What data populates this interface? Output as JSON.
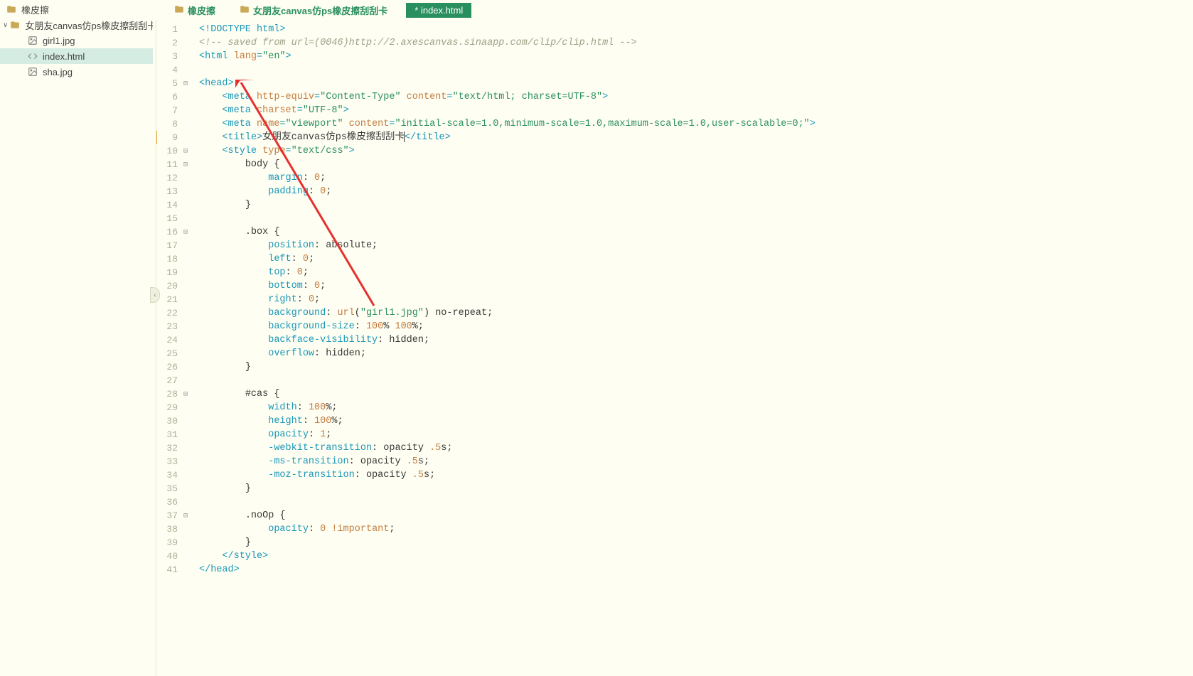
{
  "sidebar": {
    "items": [
      {
        "name": "folder-root",
        "label": "橡皮擦",
        "icon": "folder",
        "level": 0,
        "chevron": ""
      },
      {
        "name": "folder-project",
        "label": "女朋友canvas仿ps橡皮擦刮刮卡",
        "icon": "folder",
        "level": 1,
        "chevron": "∨",
        "expanded": true
      },
      {
        "name": "file-girl1",
        "label": "girl1.jpg",
        "icon": "image",
        "level": 2
      },
      {
        "name": "file-index",
        "label": "index.html",
        "icon": "code",
        "level": 2,
        "active": true
      },
      {
        "name": "file-sha",
        "label": "sha.jpg",
        "icon": "image",
        "level": 2
      }
    ]
  },
  "breadcrumbs": {
    "items": [
      {
        "label": "橡皮擦",
        "type": "folder"
      },
      {
        "label": "女朋友canvas仿ps橡皮擦刮刮卡",
        "type": "folder"
      },
      {
        "label": "* index.html",
        "type": "tab",
        "active": true
      }
    ]
  },
  "editor": {
    "line_count": 41,
    "modified_line": 9,
    "fold_lines": [
      5,
      10,
      11,
      16,
      28,
      37
    ],
    "lines": [
      {
        "n": 1,
        "tokens": [
          [
            "c-tag",
            "<!DOCTYPE "
          ],
          [
            "c-doctype",
            "html"
          ],
          [
            "c-tag",
            ">"
          ]
        ]
      },
      {
        "n": 2,
        "tokens": [
          [
            "c-comment",
            "<!-- saved from url=(0046)http://2.axescanvas.sinaapp.com/clip/clip.html -->"
          ]
        ]
      },
      {
        "n": 3,
        "tokens": [
          [
            "c-tag",
            "<html "
          ],
          [
            "c-attr",
            "lang"
          ],
          [
            "c-tag",
            "="
          ],
          [
            "c-string",
            "\"en\""
          ],
          [
            "c-tag",
            ">"
          ]
        ]
      },
      {
        "n": 4,
        "tokens": []
      },
      {
        "n": 5,
        "tokens": [
          [
            "c-tag",
            "<head>"
          ]
        ]
      },
      {
        "n": 6,
        "indent": 1,
        "tokens": [
          [
            "c-tag",
            "<meta "
          ],
          [
            "c-attr",
            "http-equiv"
          ],
          [
            "c-tag",
            "="
          ],
          [
            "c-string",
            "\"Content-Type\""
          ],
          [
            "c-tag",
            " "
          ],
          [
            "c-attr",
            "content"
          ],
          [
            "c-tag",
            "="
          ],
          [
            "c-string",
            "\"text/html; charset=UTF-8\""
          ],
          [
            "c-tag",
            ">"
          ]
        ]
      },
      {
        "n": 7,
        "indent": 1,
        "tokens": [
          [
            "c-tag",
            "<meta "
          ],
          [
            "c-attr",
            "charset"
          ],
          [
            "c-tag",
            "="
          ],
          [
            "c-string",
            "\"UTF-8\""
          ],
          [
            "c-tag",
            ">"
          ]
        ]
      },
      {
        "n": 8,
        "indent": 1,
        "tokens": [
          [
            "c-tag",
            "<meta "
          ],
          [
            "c-attr",
            "name"
          ],
          [
            "c-tag",
            "="
          ],
          [
            "c-string",
            "\"viewport\""
          ],
          [
            "c-tag",
            " "
          ],
          [
            "c-attr",
            "content"
          ],
          [
            "c-tag",
            "="
          ],
          [
            "c-string",
            "\"initial-scale=1.0,minimum-scale=1.0,maximum-scale=1.0,user-scalable=0;\""
          ],
          [
            "c-tag",
            ">"
          ]
        ]
      },
      {
        "n": 9,
        "indent": 1,
        "tokens": [
          [
            "c-tag",
            "<title>"
          ],
          [
            "c-text",
            "女朋友canvas仿ps橡皮擦刮刮卡"
          ],
          [
            "cursor",
            ""
          ],
          [
            "c-tag",
            "</title>"
          ]
        ]
      },
      {
        "n": 10,
        "indent": 1,
        "tokens": [
          [
            "c-tag",
            "<style "
          ],
          [
            "c-attr",
            "type"
          ],
          [
            "c-tag",
            "="
          ],
          [
            "c-string",
            "\"text/css\""
          ],
          [
            "c-tag",
            ">"
          ]
        ]
      },
      {
        "n": 11,
        "indent": 2,
        "tokens": [
          [
            "c-sel",
            "body "
          ],
          [
            "c-punc",
            "{"
          ]
        ]
      },
      {
        "n": 12,
        "indent": 3,
        "tokens": [
          [
            "c-prop",
            "margin"
          ],
          [
            "c-punc",
            ": "
          ],
          [
            "c-num",
            "0"
          ],
          [
            "c-punc",
            ";"
          ]
        ]
      },
      {
        "n": 13,
        "indent": 3,
        "tokens": [
          [
            "c-prop",
            "padding"
          ],
          [
            "c-punc",
            ": "
          ],
          [
            "c-num",
            "0"
          ],
          [
            "c-punc",
            ";"
          ]
        ]
      },
      {
        "n": 14,
        "indent": 2,
        "tokens": [
          [
            "c-punc",
            "}"
          ]
        ]
      },
      {
        "n": 15,
        "tokens": []
      },
      {
        "n": 16,
        "indent": 2,
        "tokens": [
          [
            "c-sel",
            ".box "
          ],
          [
            "c-punc",
            "{"
          ]
        ]
      },
      {
        "n": 17,
        "indent": 3,
        "tokens": [
          [
            "c-prop",
            "position"
          ],
          [
            "c-punc",
            ": "
          ],
          [
            "c-val",
            "absolute"
          ],
          [
            "c-punc",
            ";"
          ]
        ]
      },
      {
        "n": 18,
        "indent": 3,
        "tokens": [
          [
            "c-prop",
            "left"
          ],
          [
            "c-punc",
            ": "
          ],
          [
            "c-num",
            "0"
          ],
          [
            "c-punc",
            ";"
          ]
        ]
      },
      {
        "n": 19,
        "indent": 3,
        "tokens": [
          [
            "c-prop",
            "top"
          ],
          [
            "c-punc",
            ": "
          ],
          [
            "c-num",
            "0"
          ],
          [
            "c-punc",
            ";"
          ]
        ]
      },
      {
        "n": 20,
        "indent": 3,
        "tokens": [
          [
            "c-prop",
            "bottom"
          ],
          [
            "c-punc",
            ": "
          ],
          [
            "c-num",
            "0"
          ],
          [
            "c-punc",
            ";"
          ]
        ]
      },
      {
        "n": 21,
        "indent": 3,
        "tokens": [
          [
            "c-prop",
            "right"
          ],
          [
            "c-punc",
            ": "
          ],
          [
            "c-num",
            "0"
          ],
          [
            "c-punc",
            ";"
          ]
        ]
      },
      {
        "n": 22,
        "indent": 3,
        "tokens": [
          [
            "c-prop",
            "background"
          ],
          [
            "c-punc",
            ": "
          ],
          [
            "c-kw",
            "url"
          ],
          [
            "c-punc",
            "("
          ],
          [
            "c-string",
            "\"girl1.jpg\""
          ],
          [
            "c-punc",
            ") "
          ],
          [
            "c-val",
            "no-repeat"
          ],
          [
            "c-punc",
            ";"
          ]
        ]
      },
      {
        "n": 23,
        "indent": 3,
        "tokens": [
          [
            "c-prop",
            "background-size"
          ],
          [
            "c-punc",
            ": "
          ],
          [
            "c-num",
            "100"
          ],
          [
            "c-val",
            "% "
          ],
          [
            "c-num",
            "100"
          ],
          [
            "c-val",
            "%"
          ],
          [
            "c-punc",
            ";"
          ]
        ]
      },
      {
        "n": 24,
        "indent": 3,
        "tokens": [
          [
            "c-prop",
            "backface-visibility"
          ],
          [
            "c-punc",
            ": "
          ],
          [
            "c-val",
            "hidden"
          ],
          [
            "c-punc",
            ";"
          ]
        ]
      },
      {
        "n": 25,
        "indent": 3,
        "tokens": [
          [
            "c-prop",
            "overflow"
          ],
          [
            "c-punc",
            ": "
          ],
          [
            "c-val",
            "hidden"
          ],
          [
            "c-punc",
            ";"
          ]
        ]
      },
      {
        "n": 26,
        "indent": 2,
        "tokens": [
          [
            "c-punc",
            "}"
          ]
        ]
      },
      {
        "n": 27,
        "tokens": []
      },
      {
        "n": 28,
        "indent": 2,
        "tokens": [
          [
            "c-sel",
            "#cas "
          ],
          [
            "c-punc",
            "{"
          ]
        ]
      },
      {
        "n": 29,
        "indent": 3,
        "tokens": [
          [
            "c-prop",
            "width"
          ],
          [
            "c-punc",
            ": "
          ],
          [
            "c-num",
            "100"
          ],
          [
            "c-val",
            "%"
          ],
          [
            "c-punc",
            ";"
          ]
        ]
      },
      {
        "n": 30,
        "indent": 3,
        "tokens": [
          [
            "c-prop",
            "height"
          ],
          [
            "c-punc",
            ": "
          ],
          [
            "c-num",
            "100"
          ],
          [
            "c-val",
            "%"
          ],
          [
            "c-punc",
            ";"
          ]
        ]
      },
      {
        "n": 31,
        "indent": 3,
        "tokens": [
          [
            "c-prop",
            "opacity"
          ],
          [
            "c-punc",
            ": "
          ],
          [
            "c-num",
            "1"
          ],
          [
            "c-punc",
            ";"
          ]
        ]
      },
      {
        "n": 32,
        "indent": 3,
        "tokens": [
          [
            "c-prop",
            "-webkit-transition"
          ],
          [
            "c-punc",
            ": "
          ],
          [
            "c-val",
            "opacity "
          ],
          [
            "c-num",
            ".5"
          ],
          [
            "c-val",
            "s"
          ],
          [
            "c-punc",
            ";"
          ]
        ]
      },
      {
        "n": 33,
        "indent": 3,
        "tokens": [
          [
            "c-prop",
            "-ms-transition"
          ],
          [
            "c-punc",
            ": "
          ],
          [
            "c-val",
            "opacity "
          ],
          [
            "c-num",
            ".5"
          ],
          [
            "c-val",
            "s"
          ],
          [
            "c-punc",
            ";"
          ]
        ]
      },
      {
        "n": 34,
        "indent": 3,
        "tokens": [
          [
            "c-prop",
            "-moz-transition"
          ],
          [
            "c-punc",
            ": "
          ],
          [
            "c-val",
            "opacity "
          ],
          [
            "c-num",
            ".5"
          ],
          [
            "c-val",
            "s"
          ],
          [
            "c-punc",
            ";"
          ]
        ]
      },
      {
        "n": 35,
        "indent": 2,
        "tokens": [
          [
            "c-punc",
            "}"
          ]
        ]
      },
      {
        "n": 36,
        "tokens": []
      },
      {
        "n": 37,
        "indent": 2,
        "tokens": [
          [
            "c-sel",
            ".noOp "
          ],
          [
            "c-punc",
            "{"
          ]
        ]
      },
      {
        "n": 38,
        "indent": 3,
        "tokens": [
          [
            "c-prop",
            "opacity"
          ],
          [
            "c-punc",
            ": "
          ],
          [
            "c-num",
            "0"
          ],
          [
            "c-punc",
            " "
          ],
          [
            "c-kw",
            "!important"
          ],
          [
            "c-punc",
            ";"
          ]
        ]
      },
      {
        "n": 39,
        "indent": 2,
        "tokens": [
          [
            "c-punc",
            "}"
          ]
        ]
      },
      {
        "n": 40,
        "indent": 1,
        "tokens": [
          [
            "c-tag",
            "</style>"
          ]
        ]
      },
      {
        "n": 41,
        "tokens": [
          [
            "c-tag",
            "</head>"
          ]
        ]
      }
    ]
  }
}
